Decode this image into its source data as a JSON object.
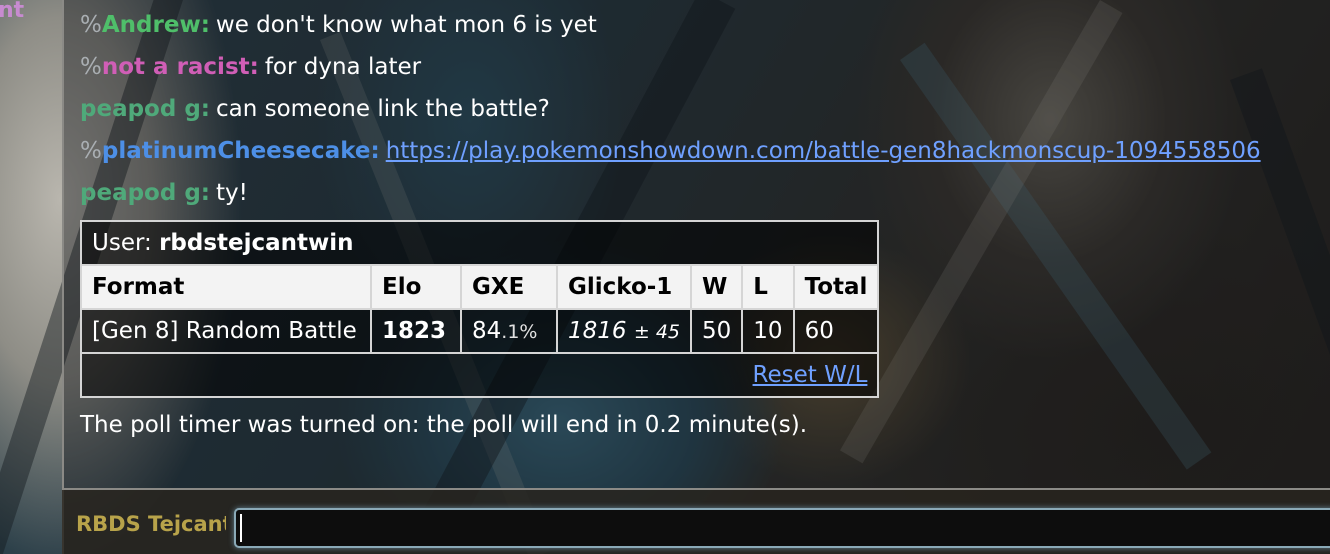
{
  "sidebar": {
    "cut_text": "nt"
  },
  "messages": [
    {
      "rank": "%",
      "user": "Andrew:",
      "color": "#4fbf6a",
      "text": "we don't know what mon 6 is yet"
    },
    {
      "rank": "%",
      "user": "not a racist:",
      "color": "#d05eb6",
      "text": "for dyna later"
    },
    {
      "rank": "",
      "user": "peapod g:",
      "color": "#4fa97a",
      "text": "can someone link the battle?"
    },
    {
      "rank": "%",
      "user": "platinumCheesecake:",
      "color": "#4d8fe6",
      "link": "https://play.pokemonshowdown.com/battle-gen8hackmonscup-1094558506"
    },
    {
      "rank": "",
      "user": "peapod g:",
      "color": "#4fa97a",
      "text": "ty!"
    }
  ],
  "ranking": {
    "caption_label": "User:",
    "username": "rbdstejcantwin",
    "headers": [
      "Format",
      "Elo",
      "GXE",
      "Glicko-1",
      "W",
      "L",
      "Total"
    ],
    "row": {
      "format": "[Gen 8] Random Battle",
      "elo": "1823",
      "gxe_main": "84",
      "gxe_dec": ".1%",
      "glicko": "1816",
      "glicko_dev": "± 45",
      "w": "50",
      "l": "10",
      "total": "60"
    },
    "reset_label": "Reset W/L"
  },
  "poll_notice": "The poll timer was turned on: the poll will end in 0.2 minute(s).",
  "composer": {
    "username": "RBDS Tejcantwin",
    "input_value": ""
  }
}
